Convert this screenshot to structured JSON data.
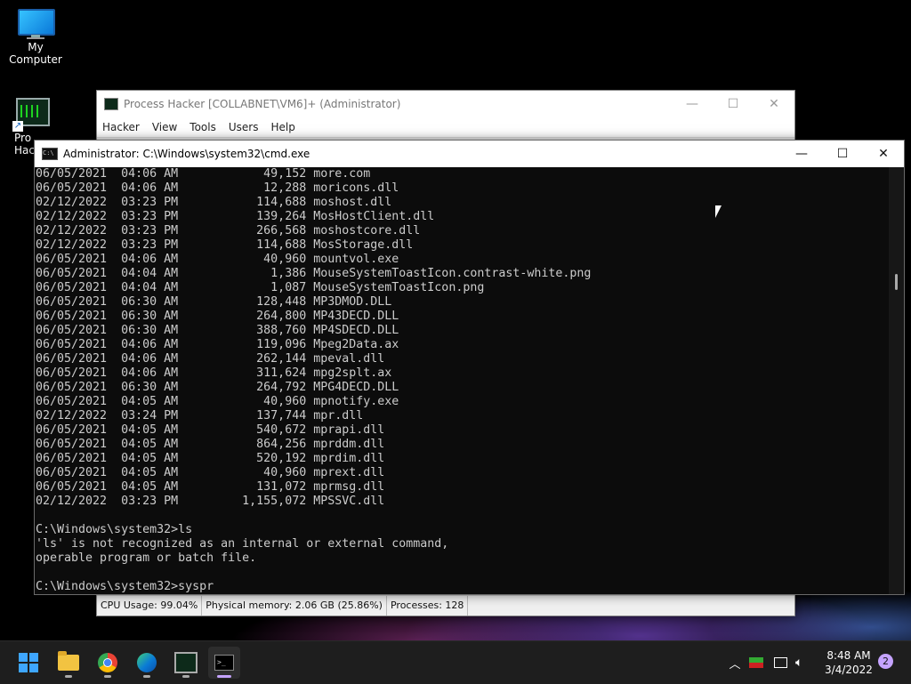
{
  "desktop": {
    "icons": [
      {
        "label": "My Computer"
      },
      {
        "label": "Pro Hac"
      }
    ]
  },
  "process_hacker": {
    "title": "Process Hacker [COLLABNET\\VM6]+ (Administrator)",
    "menu": [
      "Hacker",
      "View",
      "Tools",
      "Users",
      "Help"
    ],
    "status": {
      "cpu": "CPU Usage: 99.04%",
      "memory": "Physical memory: 2.06 GB (25.86%)",
      "processes": "Processes: 128"
    }
  },
  "cmd": {
    "title": "Administrator: C:\\Windows\\system32\\cmd.exe",
    "lines": [
      "06/05/2021  04:06 AM            49,152 more.com",
      "06/05/2021  04:06 AM            12,288 moricons.dll",
      "02/12/2022  03:23 PM           114,688 moshost.dll",
      "02/12/2022  03:23 PM           139,264 MosHostClient.dll",
      "02/12/2022  03:23 PM           266,568 moshostcore.dll",
      "02/12/2022  03:23 PM           114,688 MosStorage.dll",
      "06/05/2021  04:06 AM            40,960 mountvol.exe",
      "06/05/2021  04:04 AM             1,386 MouseSystemToastIcon.contrast-white.png",
      "06/05/2021  04:04 AM             1,087 MouseSystemToastIcon.png",
      "06/05/2021  06:30 AM           128,448 MP3DMOD.DLL",
      "06/05/2021  06:30 AM           264,800 MP43DECD.DLL",
      "06/05/2021  06:30 AM           388,760 MP4SDECD.DLL",
      "06/05/2021  04:06 AM           119,096 Mpeg2Data.ax",
      "06/05/2021  04:06 AM           262,144 mpeval.dll",
      "06/05/2021  04:06 AM           311,624 mpg2splt.ax",
      "06/05/2021  06:30 AM           264,792 MPG4DECD.DLL",
      "06/05/2021  04:05 AM            40,960 mpnotify.exe",
      "02/12/2022  03:24 PM           137,744 mpr.dll",
      "06/05/2021  04:05 AM           540,672 mprapi.dll",
      "06/05/2021  04:05 AM           864,256 mprddm.dll",
      "06/05/2021  04:05 AM           520,192 mprdim.dll",
      "06/05/2021  04:05 AM            40,960 mprext.dll",
      "06/05/2021  04:05 AM           131,072 mprmsg.dll",
      "02/12/2022  03:23 PM         1,155,072 MPSSVC.dll",
      "",
      "C:\\Windows\\system32>ls",
      "'ls' is not recognized as an internal or external command,",
      "operable program or batch file.",
      "",
      "C:\\Windows\\system32>syspr"
    ]
  },
  "taskbar": {
    "time": "8:48 AM",
    "date": "3/4/2022",
    "notifications": "2"
  }
}
